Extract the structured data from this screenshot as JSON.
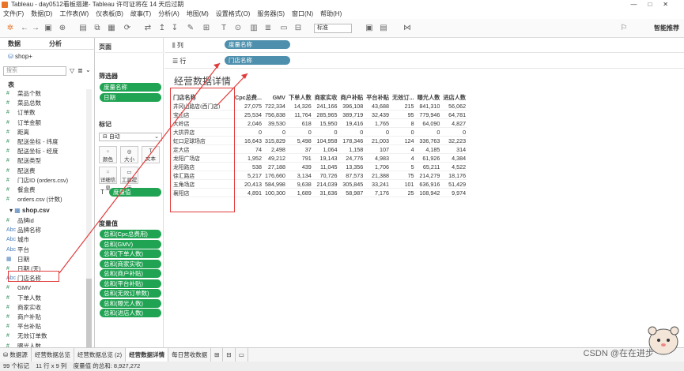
{
  "window": {
    "title": "Tableau - day0512看板搭建- Tableau 许可证将在 14 天后过期",
    "controls": [
      "—",
      "□",
      "✕"
    ]
  },
  "menu": [
    "文件(F)",
    "数据(D)",
    "工作表(W)",
    "仪表板(B)",
    "故事(T)",
    "分析(A)",
    "地图(M)",
    "设置格式(O)",
    "服务器(S)",
    "窗口(N)",
    "帮助(H)"
  ],
  "toolbar": {
    "fit_select": "标准",
    "smart_button": "智能推荐"
  },
  "left_panel": {
    "tab_data": "数据",
    "tab_analysis": "分析",
    "datasource": "shop+",
    "search_placeholder": "搜索",
    "table_header": "表",
    "fields_top": [
      {
        "icon": "#",
        "name": "菜品个数"
      },
      {
        "icon": "#",
        "name": "菜品总数"
      },
      {
        "icon": "#",
        "name": "订单数"
      },
      {
        "icon": "#",
        "name": "订单金额"
      },
      {
        "icon": "#",
        "name": "距离"
      },
      {
        "icon": "#",
        "name": "配送坐标 - 纬度"
      },
      {
        "icon": "#",
        "name": "配送坐标 - 经度"
      },
      {
        "icon": "#",
        "name": "配送类型"
      },
      {
        "icon": "#",
        "name": "配送费"
      },
      {
        "icon": "#",
        "name": "门店ID (orders.csv)"
      },
      {
        "icon": "#",
        "name": "餐盒费"
      },
      {
        "icon": "#",
        "name": "orders.csv (计数)"
      }
    ],
    "shop_header": "shop.csv",
    "fields_shop": [
      {
        "icon": "#",
        "name": "品牌id"
      },
      {
        "icon": "Abc",
        "name": "品牌名称"
      },
      {
        "icon": "Abc",
        "name": "城市"
      },
      {
        "icon": "Abc",
        "name": "平台"
      },
      {
        "icon": "▦",
        "name": "日期"
      },
      {
        "icon": "#",
        "name": "日期 (天)"
      },
      {
        "icon": "Abc",
        "name": "门店名称"
      },
      {
        "icon": "#",
        "name": "GMV"
      },
      {
        "icon": "#",
        "name": "下单人数"
      },
      {
        "icon": "#",
        "name": "商家实收"
      },
      {
        "icon": "#",
        "name": "商户补贴"
      },
      {
        "icon": "#",
        "name": "平台补贴"
      },
      {
        "icon": "#",
        "name": "无效订单数"
      },
      {
        "icon": "#",
        "name": "曝光人数"
      }
    ]
  },
  "cards": {
    "pages": "页面",
    "filters": "筛选器",
    "filter_pills": [
      "度量名称",
      "日期"
    ],
    "marks": "标记",
    "marks_type": "自动",
    "mark_buttons": [
      "颜色",
      "大小",
      "文本",
      "详细信息",
      "工具提示"
    ],
    "marks_pill": "度量值",
    "measure_values": "度量值",
    "measure_pills": [
      "总和(Cpc总费用)",
      "总和(GMV)",
      "总和(下单人数)",
      "总和(商家实收)",
      "总和(商户补贴)",
      "总和(平台补贴)",
      "总和(无效订单数)",
      "总和(曝光人数)",
      "总和(进店人数)"
    ]
  },
  "shelves": {
    "columns_label": "列",
    "columns_pill": "度量名称",
    "rows_label": "行",
    "rows_pill": "门店名称"
  },
  "view": {
    "title": "经营数据详情",
    "columns": [
      "门店名称",
      "Cpc总费...",
      "GMV",
      "下单人数",
      "商家实收",
      "商户补贴",
      "平台补贴",
      "无效订...",
      "曝光人数",
      "进店人数"
    ],
    "rows": [
      [
        "井冈山路店(西门店)",
        "27,075",
        "722,334",
        "14,326",
        "241,166",
        "396,108",
        "43,688",
        "215",
        "841,310",
        "56,062"
      ],
      [
        "宝山店",
        "25,534",
        "756,838",
        "11,764",
        "285,965",
        "389,719",
        "32,439",
        "95",
        "779,946",
        "64,781"
      ],
      [
        "大岭店",
        "2,046",
        "39,530",
        "618",
        "15,950",
        "19,416",
        "1,765",
        "8",
        "64,090",
        "4,827"
      ],
      [
        "大拱界店",
        "0",
        "0",
        "0",
        "0",
        "0",
        "0",
        "0",
        "0",
        "0"
      ],
      [
        "虹口足球场店",
        "16,643",
        "315,829",
        "5,498",
        "104,958",
        "178,346",
        "21,003",
        "124",
        "336,763",
        "32,223"
      ],
      [
        "定大店",
        "74",
        "2,498",
        "37",
        "1,064",
        "1,158",
        "107",
        "4",
        "4,185",
        "314"
      ],
      [
        "龙阳广场店",
        "1,952",
        "49,212",
        "791",
        "19,143",
        "24,776",
        "4,983",
        "4",
        "61,926",
        "4,384"
      ],
      [
        "龙阳路店",
        "538",
        "27,188",
        "439",
        "11,045",
        "13,356",
        "1,706",
        "5",
        "65,211",
        "4,522"
      ],
      [
        "徐汇路店",
        "5,217",
        "176,660",
        "3,134",
        "70,726",
        "87,573",
        "21,388",
        "75",
        "214,279",
        "18,176"
      ],
      [
        "五角场店",
        "20,413",
        "584,998",
        "9,638",
        "214,039",
        "305,845",
        "33,241",
        "101",
        "636,916",
        "51,429"
      ],
      [
        "襄阳店",
        "4,891",
        "100,300",
        "1,689",
        "31,636",
        "58,987",
        "7,176",
        "25",
        "108,942",
        "9,974"
      ]
    ]
  },
  "bottom_tabs": [
    "数据源",
    "经营数据总览",
    "经营数据总览 (2)",
    "经营数据详情",
    "每日营收数据"
  ],
  "active_tab_index": 3,
  "status": {
    "marks": "99 个标记",
    "rows": "11 行 x 9 列",
    "sum": "度量值 的总和: 8,927,272"
  },
  "watermark": "CSDN @在在进步",
  "colors": {
    "pill_green": "#20a453",
    "pill_blue": "#4d8fac",
    "annotation_red": "#e23b3b"
  }
}
